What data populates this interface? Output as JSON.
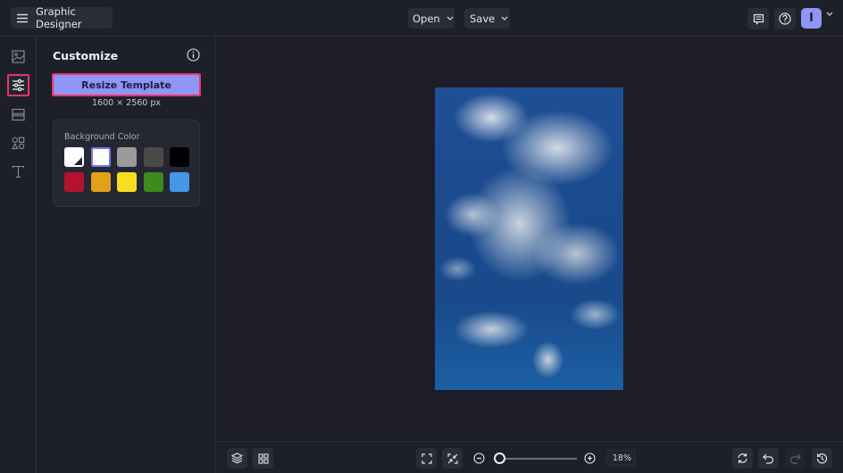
{
  "header": {
    "app_title": "Graphic Designer",
    "open_label": "Open",
    "save_label": "Save",
    "avatar_initial": "I",
    "icons": [
      "menu-icon",
      "chevron-down-icon",
      "comment-icon",
      "help-icon"
    ]
  },
  "rail": {
    "items": [
      {
        "name": "photos",
        "icon": "image-icon",
        "active": false
      },
      {
        "name": "customize",
        "icon": "sliders-icon",
        "active": true
      },
      {
        "name": "layouts",
        "icon": "layout-icon",
        "active": false
      },
      {
        "name": "graphics",
        "icon": "shapes-icon",
        "active": false
      },
      {
        "name": "text",
        "icon": "text-icon",
        "active": false
      }
    ]
  },
  "panel": {
    "title": "Customize",
    "resize_button": "Resize Template",
    "dimensions": "1600 × 2560 px",
    "background_color": {
      "label": "Background Color",
      "swatches": [
        {
          "name": "transparent",
          "color": "#ffffff"
        },
        {
          "name": "white",
          "color": "#ffffff",
          "selected": true
        },
        {
          "name": "gray",
          "color": "#9b9b9b"
        },
        {
          "name": "dark-gray",
          "color": "#4a4a4a"
        },
        {
          "name": "black",
          "color": "#000000"
        },
        {
          "name": "red",
          "color": "#b5122d"
        },
        {
          "name": "orange",
          "color": "#e0a11b"
        },
        {
          "name": "yellow",
          "color": "#f6e01d"
        },
        {
          "name": "green",
          "color": "#3f8a1b"
        },
        {
          "name": "blue",
          "color": "#4597e8"
        }
      ]
    }
  },
  "canvas": {
    "image_description": "blue sky with white clouds"
  },
  "bottombar": {
    "zoom_percent": "18%",
    "zoom_slider_value": 0.18,
    "icons": [
      "layers-icon",
      "grid-icon",
      "fit-screen-icon",
      "shrink-icon",
      "zoom-out-icon",
      "zoom-in-icon",
      "replace-icon",
      "undo-icon",
      "redo-icon",
      "history-icon"
    ]
  },
  "colors": {
    "accent": "#8f95f4",
    "highlight": "#e8356d",
    "background": "#1c1d27"
  }
}
